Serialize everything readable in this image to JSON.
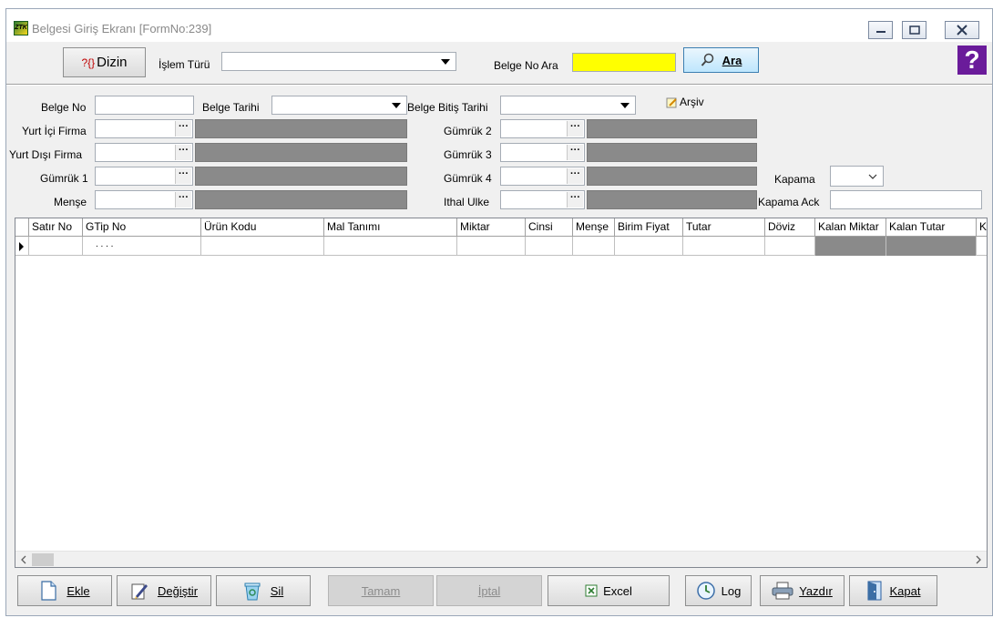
{
  "window": {
    "title": "Belgesi Giriş Ekranı [FormNo:239]",
    "icon_text": "ZTK"
  },
  "toolbar": {
    "dizin_label": "Dizin",
    "dizin_prefix": "?{}",
    "islem_turu_label": "İşlem Türü",
    "islem_turu_value": "",
    "belge_no_ara_label": "Belge No Ara",
    "belge_no_ara_value": "",
    "ara_label": "Ara",
    "help_label": "?"
  },
  "form": {
    "belge_no_label": "Belge No",
    "belge_tarihi_label": "Belge Tarihi",
    "belge_bitis_tarihi_label": "Belge Bitiş Tarihi",
    "arsiv_label": "Arşiv",
    "yurt_ici_firma_label": "Yurt İçi Firma",
    "yurt_disi_firma_label": "Yurt Dışı Firma",
    "gumruk1_label": "Gümrük 1",
    "mense_label": "Menşe",
    "gumruk2_label": "Gümrük 2",
    "gumruk3_label": "Gümrük 3",
    "gumruk4_label": "Gümrük 4",
    "ithal_ulke_label": "Ithal Ulke",
    "kapama_label": "Kapama",
    "kapama_ack_label": "Kapama Ack",
    "lookup_dots": "···"
  },
  "grid": {
    "columns": [
      "Satır No",
      "GTip No",
      "Ürün Kodu",
      "Mal Tanımı",
      "Miktar",
      "Cinsi",
      "Menşe",
      "Birim Fiyat",
      "Tutar",
      "Döviz",
      "Kalan Miktar",
      "Kalan Tutar",
      "K"
    ],
    "row1_gtip_mask": ". . . ."
  },
  "buttons": {
    "ekle": "Ekle",
    "degistir": "Değiştir",
    "sil": "Sil",
    "tamam": "Tamam",
    "iptal": "İptal",
    "excel": "Excel",
    "log": "Log",
    "yazdir": "Yazdır",
    "kapat": "Kapat"
  },
  "colors": {
    "highlight_input": "#ffff00",
    "readonly_field": "#8a8a8a",
    "help_icon": "#6a1b9a"
  }
}
